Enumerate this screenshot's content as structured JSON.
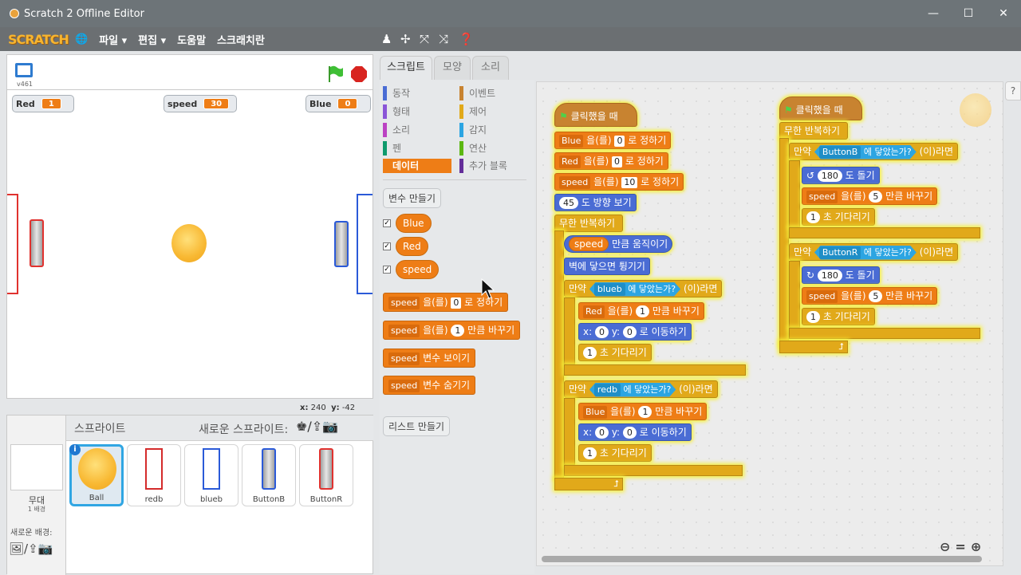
{
  "window": {
    "title": "Scratch 2 Offline Editor",
    "minimize": "—",
    "maximize": "☐",
    "close": "✕"
  },
  "menu": {
    "logo": "SCRATCH",
    "file": "파일 ▾",
    "edit": "편집 ▾",
    "help": "도움말",
    "about": "스크래치란"
  },
  "stage": {
    "version": "v461",
    "monitors": [
      {
        "name": "Red",
        "value": "1"
      },
      {
        "name": "speed",
        "value": "30"
      },
      {
        "name": "Blue",
        "value": "0"
      }
    ],
    "x_label": "x:",
    "x_value": "240",
    "y_label": "y:",
    "y_value": "-42"
  },
  "sprites": {
    "header": "스프라이트",
    "new_sprite": "새로운 스프라이트:",
    "stage_name": "무대",
    "stage_backdrops": "1 배경",
    "new_backdrop": "새로운 배경:",
    "items": [
      "Ball",
      "redb",
      "blueb",
      "ButtonB",
      "ButtonR"
    ]
  },
  "tabs": [
    "스크립트",
    "모양",
    "소리"
  ],
  "categories": {
    "motion": "동작",
    "looks": "형태",
    "sound": "소리",
    "pen": "펜",
    "data": "데이터",
    "events": "이벤트",
    "control": "제어",
    "sensing": "감지",
    "operators": "연산",
    "more": "추가 블록"
  },
  "palette": {
    "make_var": "변수 만들기",
    "vars": [
      "Blue",
      "Red",
      "speed"
    ],
    "set": "을(를)",
    "set_to": "로 정하기",
    "set_val": "0",
    "change_val": "1",
    "change_by": "만큼 바꾸기",
    "show": "변수 보이기",
    "hide": "변수 숨기기",
    "make_list": "리스트 만들기",
    "var": "speed"
  },
  "script1": {
    "hat": "클릭했을 때",
    "s1": [
      "Blue",
      "을(를)",
      "0",
      "로 정하기"
    ],
    "s2": [
      "Red",
      "을(를)",
      "0",
      "로 정하기"
    ],
    "s3": [
      "speed",
      "을(를)",
      "10",
      "로 정하기"
    ],
    "dir": [
      "45",
      "도 방향 보기"
    ],
    "forever": "무한 반복하기",
    "move": [
      "speed",
      "만큼 움직이기"
    ],
    "bounce": "벽에 닿으면 튕기기",
    "if1": [
      "만약",
      "blueb",
      "에 닿았는가?",
      "(이)라면"
    ],
    "c1": [
      "Red",
      "을(를)",
      "1",
      "만큼 바꾸기"
    ],
    "go": [
      "x:",
      "0",
      "y:",
      "0",
      "로 이동하기"
    ],
    "wait": [
      "1",
      "초 기다리기"
    ],
    "if2": [
      "만약",
      "redb",
      "에 닿았는가?",
      "(이)라면"
    ],
    "c2": [
      "Blue",
      "을(를)",
      "1",
      "만큼 바꾸기"
    ]
  },
  "script2": {
    "hat": "클릭했을 때",
    "forever": "무한 반복하기",
    "if1": [
      "만약",
      "ButtonB",
      "에 닿았는가?",
      "(이)라면"
    ],
    "turn1": [
      "180",
      "도 돌기"
    ],
    "ch": [
      "speed",
      "을(를)",
      "5",
      "만큼 바꾸기"
    ],
    "wait": [
      "1",
      "초 기다리기"
    ],
    "if2": [
      "만약",
      "ButtonR",
      "에 닿았는가?",
      "(이)라면"
    ],
    "turn2": [
      "180",
      "도 돌기"
    ]
  }
}
